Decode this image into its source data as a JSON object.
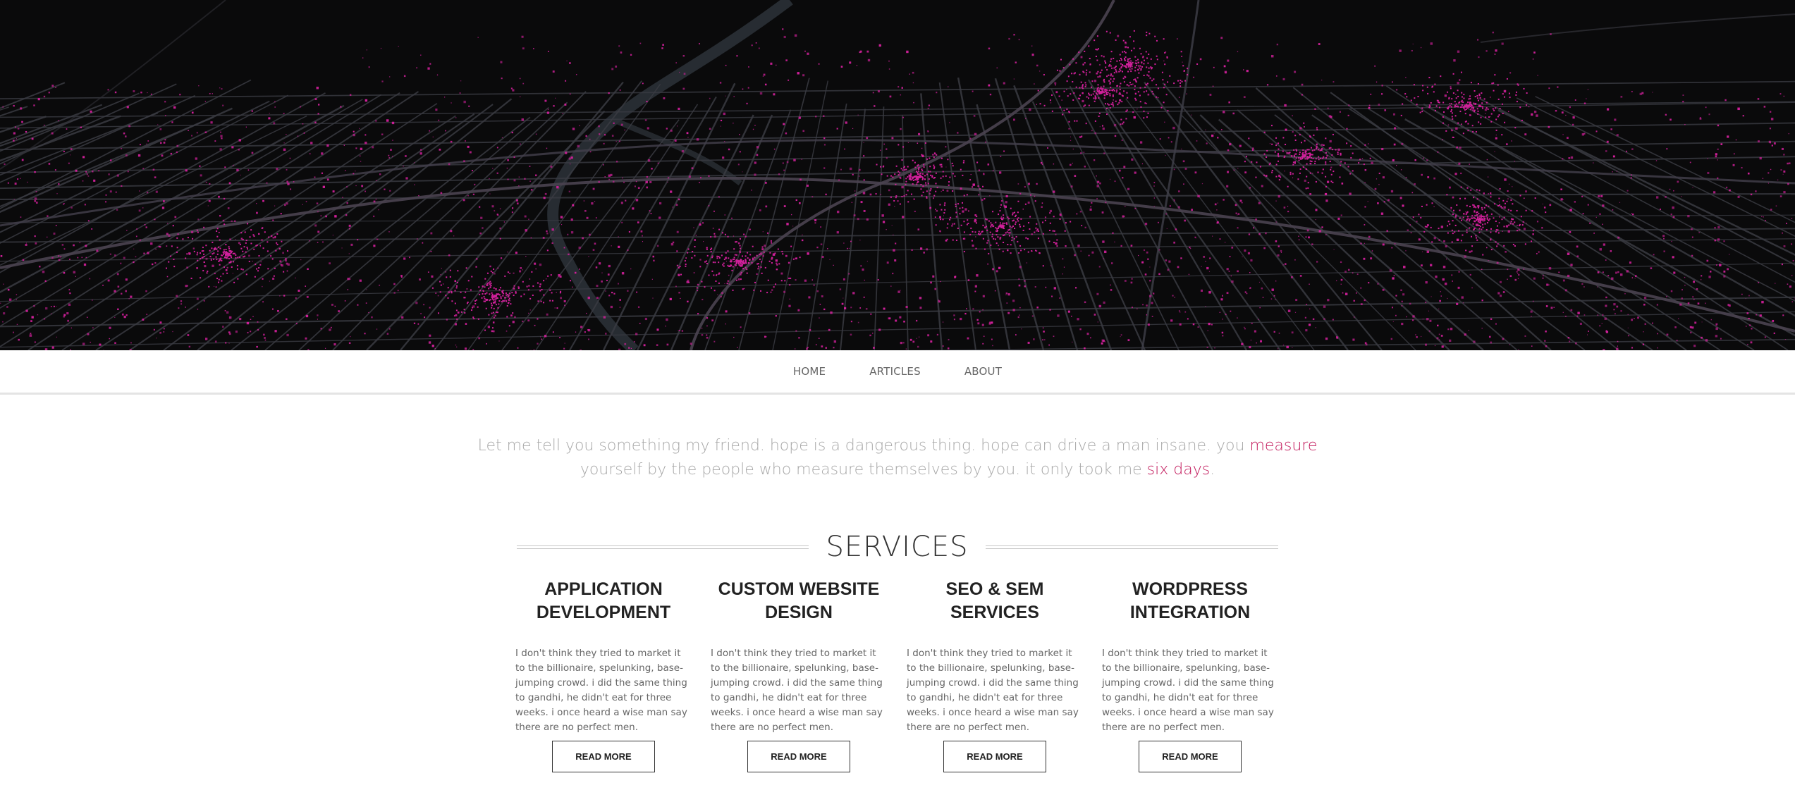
{
  "hero": {
    "image": "dark city street map with magenta data points",
    "colors": {
      "background": "#0a0a0b",
      "streets": "#3a3b42",
      "river": "#2a3036",
      "points": "#d0209a"
    }
  },
  "nav": {
    "items": [
      {
        "label": "HOME"
      },
      {
        "label": "ARTICLES"
      },
      {
        "label": "ABOUT"
      }
    ]
  },
  "quote": {
    "line1_text": "Let me tell you something my friend. hope is a dangerous thing. hope can drive a man insane. you ",
    "line1_link": "measure",
    "line2_text": "yourself by the people who measure themselves by you. it only took me ",
    "line2_link": "six days",
    "line2_end": ".",
    "accent_color": "#c2185b"
  },
  "services": {
    "title": "SERVICES",
    "items": [
      {
        "title_line1": "APPLICATION",
        "title_line2": "DEVELOPMENT",
        "text": "I don't think they tried to market it to the billionaire, spelunking, base-jumping crowd. i did the same thing to gandhi, he didn't eat for three weeks. i once heard a wise man say there are no perfect men.",
        "button": "READ MORE"
      },
      {
        "title_line1": "CUSTOM WEBSITE",
        "title_line2": "DESIGN",
        "text": "I don't think they tried to market it to the billionaire, spelunking, base-jumping crowd. i did the same thing to gandhi, he didn't eat for three weeks. i once heard a wise man say there are no perfect men.",
        "button": "READ MORE"
      },
      {
        "title_line1": "SEO & SEM",
        "title_line2": "SERVICES",
        "text": "I don't think they tried to market it to the billionaire, spelunking, base-jumping crowd. i did the same thing to gandhi, he didn't eat for three weeks. i once heard a wise man say there are no perfect men.",
        "button": "READ MORE"
      },
      {
        "title_line1": "WORDPRESS",
        "title_line2": "INTEGRATION",
        "text": "I don't think they tried to market it to the billionaire, spelunking, base-jumping crowd. i did the same thing to gandhi, he didn't eat for three weeks. i once heard a wise man say there are no perfect men.",
        "button": "READ MORE"
      }
    ]
  }
}
